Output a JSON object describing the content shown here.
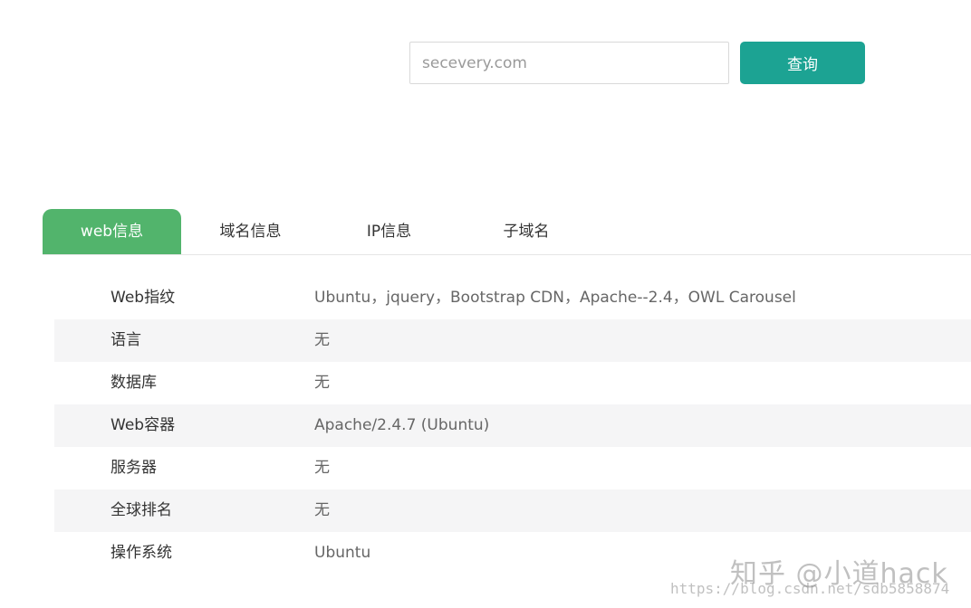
{
  "search": {
    "placeholder": "secevery.com",
    "value": "",
    "button_label": "查询"
  },
  "tabs": [
    {
      "label": "web信息",
      "active": true
    },
    {
      "label": "域名信息",
      "active": false
    },
    {
      "label": "IP信息",
      "active": false
    },
    {
      "label": "子域名",
      "active": false
    }
  ],
  "web_info": {
    "rows": [
      {
        "label": "Web指纹",
        "value": "Ubuntu，jquery，Bootstrap CDN，Apache--2.4，OWL Carousel"
      },
      {
        "label": "语言",
        "value": "无"
      },
      {
        "label": "数据库",
        "value": "无"
      },
      {
        "label": "Web容器",
        "value": "Apache/2.4.7 (Ubuntu)"
      },
      {
        "label": "服务器",
        "value": "无"
      },
      {
        "label": "全球排名",
        "value": "无"
      },
      {
        "label": "操作系统",
        "value": "Ubuntu"
      }
    ]
  },
  "watermark": {
    "main": "知乎 @小道hack",
    "url": "https://blog.csdn.net/sdb5858874"
  },
  "colors": {
    "accent_button": "#1ca393",
    "active_tab": "#52b46c",
    "row_shade": "#f5f5f6"
  }
}
